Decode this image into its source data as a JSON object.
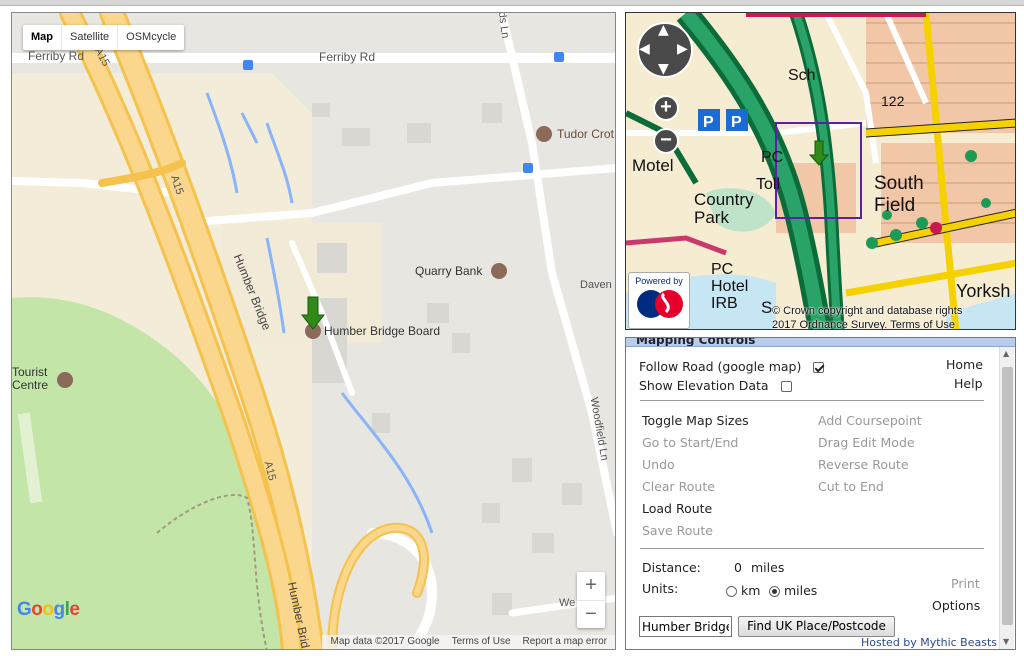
{
  "google_map": {
    "map_types": [
      "Map",
      "Satellite",
      "OSMcycle"
    ],
    "active_type": "Map",
    "labels": {
      "ferriby_rd_left": "Ferriby Rd",
      "ferriby_rd": "Ferriby Rd",
      "tudor_croft": "Tudor Crot",
      "quarry_bank": "Quarry Bank",
      "humber_bridge_board": "Humber Bridge Board",
      "tourist_centre": "Tourist\nCentre",
      "a15_top": "A15",
      "a15_mid": "A15",
      "a15_low": "A15",
      "humber_bridge_upper": "Humber Bridge",
      "humber_bridge_lower": "Humber Brid",
      "woodfield_ln": "Woodfield Ln",
      "daven": "Daven",
      "we": "We",
      "ds_ln": "ds Ln"
    },
    "zoom_in": "+",
    "zoom_out": "−",
    "logo": "Google",
    "footer": [
      "Map data ©2017 Google",
      "Terms of Use",
      "Report a map error"
    ]
  },
  "os_map": {
    "labels": {
      "motel": "Motel",
      "country_park": "Country\nPark",
      "south_field": "South\nField",
      "pc_top": "PC",
      "toll": "Toll",
      "pc_hotel": "PC\nHotel\nIRB",
      "sch": "Sch",
      "yorks": "Yorksh",
      "num122": "122",
      "s": "S"
    },
    "powered_by": "Powered by",
    "os_mark": "OS",
    "copyright": "© Crown copyright and database rights\n2017 Ordnance Survey. Terms of Use",
    "zoom_in": "+",
    "zoom_out": "−"
  },
  "controls": {
    "header": "Mapping Controls",
    "follow_road": "Follow Road (google map)",
    "follow_road_checked": true,
    "show_elevation": "Show Elevation Data",
    "show_elevation_checked": false,
    "home": "Home",
    "help": "Help",
    "left_actions": [
      {
        "label": "Toggle Map Sizes",
        "enabled": true
      },
      {
        "label": "Go to Start/End",
        "enabled": false
      },
      {
        "label": "Undo",
        "enabled": false
      },
      {
        "label": "Clear Route",
        "enabled": false
      },
      {
        "label": "Load Route",
        "enabled": true
      },
      {
        "label": "Save Route",
        "enabled": false
      }
    ],
    "right_actions": [
      {
        "label": "Add Coursepoint",
        "enabled": false
      },
      {
        "label": "Drag Edit Mode",
        "enabled": false
      },
      {
        "label": "Reverse Route",
        "enabled": false
      },
      {
        "label": "Cut to End",
        "enabled": false
      }
    ],
    "distance_label": "Distance:",
    "distance_value": "0",
    "distance_unit": "miles",
    "units_label": "Units:",
    "unit_km": "km",
    "unit_miles": "miles",
    "selected_unit": "miles",
    "print": "Print",
    "options": "Options",
    "place_input_value": "Humber Bridge",
    "find_button": "Find UK Place/Postcode",
    "hosted_by": "Hosted by Mythic Beasts"
  }
}
